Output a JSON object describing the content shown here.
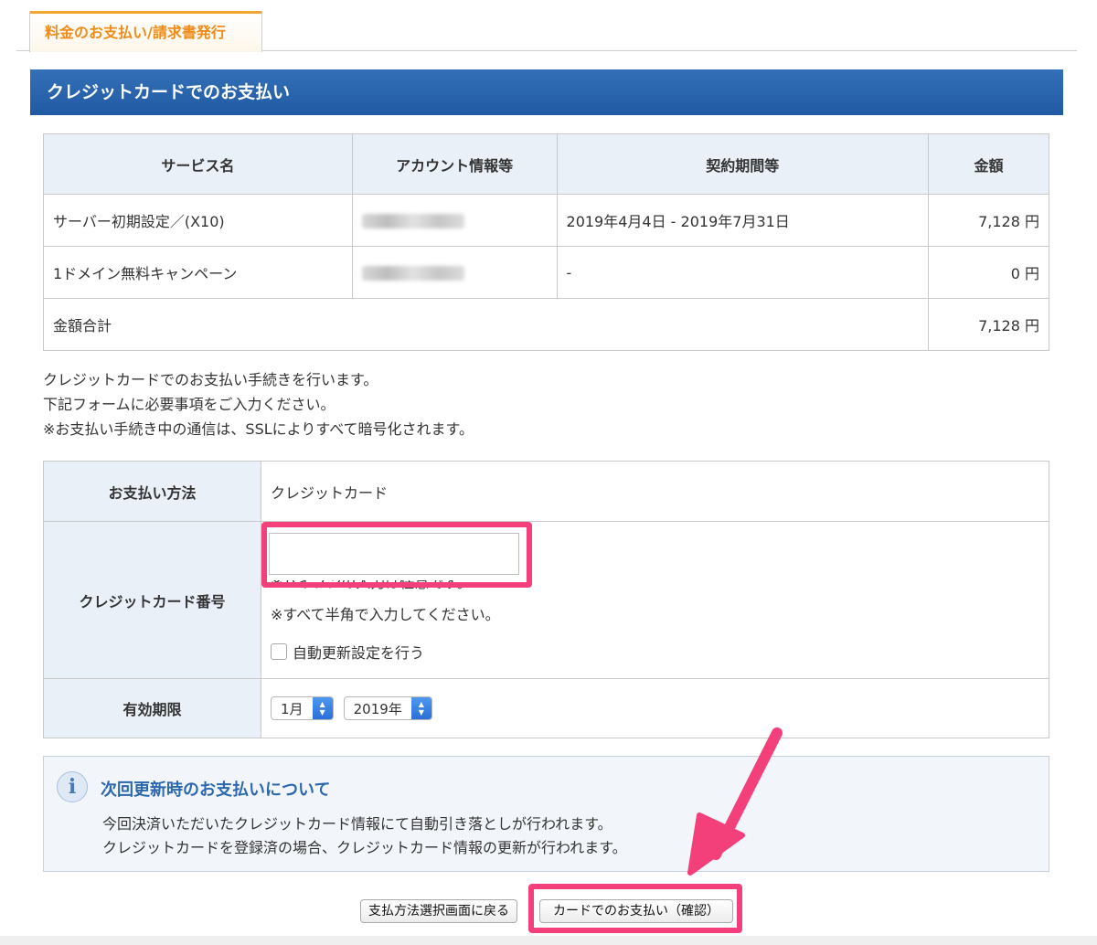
{
  "tab": {
    "label": "料金のお支払い/請求書発行"
  },
  "section": {
    "title": "クレジットカードでのお支払い"
  },
  "services_table": {
    "headers": [
      "サービス名",
      "アカウント情報等",
      "契約期間等",
      "金額"
    ],
    "rows": [
      {
        "service": "サーバー初期設定／(X10)",
        "period": "2019年4月4日 - 2019年7月31日",
        "amount": "7,128 円"
      },
      {
        "service": "1ドメイン無料キャンペーン",
        "period": "-",
        "amount": "0 円"
      }
    ],
    "total_label": "金額合計",
    "total_amount": "7,128 円"
  },
  "intro": {
    "line1": "クレジットカードでのお支払い手続きを行います。",
    "line2": "下記フォームに必要事項をご入力ください。",
    "line3": "※お支払い手続き中の通信は、SSLによりすべて暗号化されます。"
  },
  "payment_form": {
    "method_label": "お支払い方法",
    "method_value": "クレジットカード",
    "card_label": "クレジットカード番号",
    "card_number_value": "",
    "card_note1": "※ハイフンの入力は任意です。",
    "card_note2": "※すべて半角で入力してください。",
    "auto_renew_label": "自動更新設定を行う",
    "auto_renew_checked": false,
    "expiry_label": "有効期限",
    "expiry_month": "1月",
    "expiry_year": "2019年"
  },
  "info_box": {
    "icon": "info-icon",
    "title": "次回更新時のお支払いについて",
    "line1": "今回決済いただいたクレジットカード情報にて自動引き落としが行われます。",
    "line2": "クレジットカードを登録済の場合、クレジットカード情報の更新が行われます。"
  },
  "buttons": {
    "back": "支払方法選択画面に戻る",
    "confirm": "カードでのお支払い（確認）"
  },
  "annotation_color": "#f33f7a"
}
